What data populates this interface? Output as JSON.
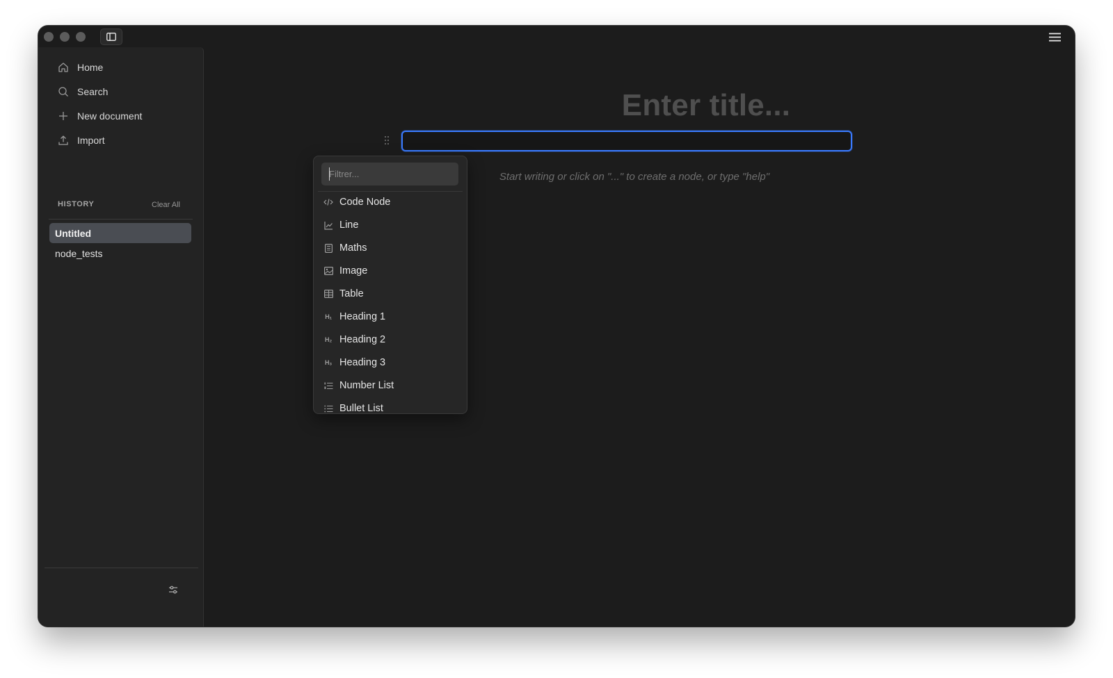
{
  "window": {
    "sidebar_toggle_icon": "sidebar-panel-icon",
    "menu_icon": "hamburger-menu-icon"
  },
  "sidebar": {
    "nav": [
      {
        "label": "Home",
        "icon": "home-icon"
      },
      {
        "label": "Search",
        "icon": "search-icon"
      },
      {
        "label": "New document",
        "icon": "plus-icon"
      },
      {
        "label": "Import",
        "icon": "upload-icon"
      }
    ],
    "history_label": "HISTORY",
    "clear_all_label": "Clear All",
    "history": [
      {
        "label": "Untitled",
        "active": true
      },
      {
        "label": "node_tests",
        "active": false
      }
    ],
    "settings_icon": "sliders-icon"
  },
  "editor": {
    "title_placeholder": "Enter title...",
    "hint": "Start writing or click on \"...\" to create a node, or type \"help\""
  },
  "node_menu": {
    "filter_placeholder": "Filtrer...",
    "items": [
      {
        "label": "Code Node",
        "icon": "code-icon"
      },
      {
        "label": "Line",
        "icon": "line-chart-icon"
      },
      {
        "label": "Maths",
        "icon": "calculator-icon"
      },
      {
        "label": "Image",
        "icon": "image-icon"
      },
      {
        "label": "Table",
        "icon": "table-icon"
      },
      {
        "label": "Heading 1",
        "icon": "heading-1-icon"
      },
      {
        "label": "Heading 2",
        "icon": "heading-2-icon"
      },
      {
        "label": "Heading 3",
        "icon": "heading-3-icon"
      },
      {
        "label": "Number List",
        "icon": "number-list-icon"
      },
      {
        "label": "Bullet List",
        "icon": "bullet-list-icon"
      }
    ]
  },
  "colors": {
    "accent": "#3a7bff",
    "window_bg": "#1c1c1c",
    "sidebar_bg": "#232323",
    "active_item_bg": "#4a4d53"
  }
}
